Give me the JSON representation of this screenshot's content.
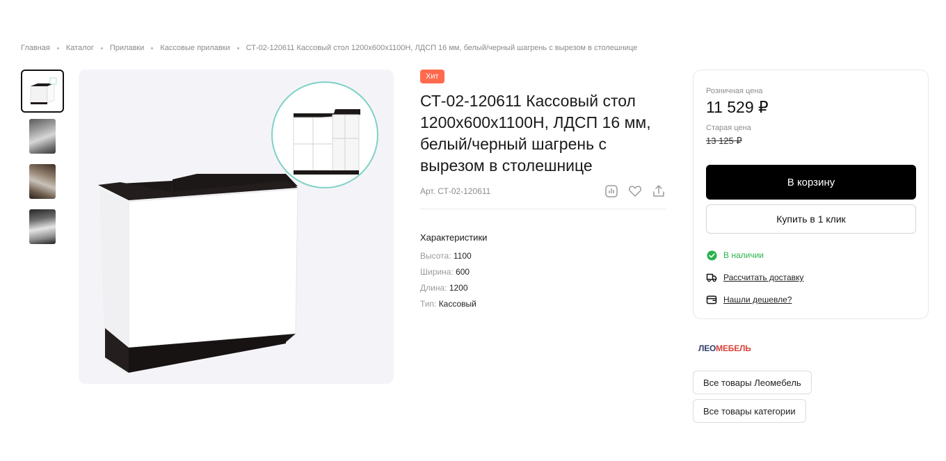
{
  "breadcrumb": {
    "items": [
      "Главная",
      "Каталог",
      "Прилавки",
      "Кассовые прилавки"
    ],
    "current": "СТ-02-120611 Кассовый стол 1200х600х1100Н, ЛДСП 16 мм, белый/черный шагрень с вырезом в столешнице"
  },
  "product": {
    "badge": "Хит",
    "title": "СТ-02-120611 Кассовый стол 1200х600х1100Н, ЛДСП 16 мм, белый/черный шагрень с вырезом в столешнице",
    "sku": "Арт. СТ-02-120611",
    "specs_title": "Характеристики",
    "specs": [
      {
        "key": "Высота:",
        "value": "1100"
      },
      {
        "key": "Ширина:",
        "value": "600"
      },
      {
        "key": "Длина:",
        "value": "1200"
      },
      {
        "key": "Тип:",
        "value": "Кассовый"
      }
    ]
  },
  "price_card": {
    "retail_label": "Розничная цена",
    "price": "11 529 ₽",
    "old_label": "Старая цена",
    "old_price": "13 125 ₽",
    "cart_button": "В корзину",
    "one_click_button": "Купить в 1 клик",
    "in_stock": "В наличии",
    "delivery": "Рассчитать доставку",
    "cheaper": "Нашли дешевле?"
  },
  "brand": {
    "logo_part1": "ЛЕО",
    "logo_part2": "МЕБЕЛЬ",
    "all_brand": "Все товары Леомебель",
    "all_category": "Все товары категории"
  },
  "colors": {
    "badge": "#ff6a4d",
    "stock": "#2bb24c",
    "accent_circle": "#7fd1c6",
    "button": "#000000"
  },
  "icons": [
    "compare-icon",
    "heart-icon",
    "share-icon",
    "check-circle-icon",
    "truck-icon",
    "wallet-icon"
  ]
}
